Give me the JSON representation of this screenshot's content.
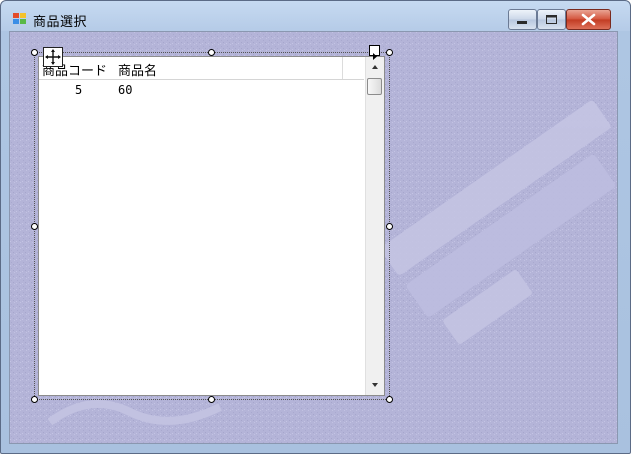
{
  "window": {
    "title": "商品選択",
    "accent_color": "#c7432b",
    "controls": {
      "minimize_icon": "minimize-icon",
      "maximize_icon": "maximize-icon",
      "close_icon": "close-icon"
    }
  },
  "grid": {
    "columns": [
      "商品コード",
      "商品名"
    ],
    "rows": [
      {
        "code": "5",
        "name": "60"
      }
    ]
  }
}
